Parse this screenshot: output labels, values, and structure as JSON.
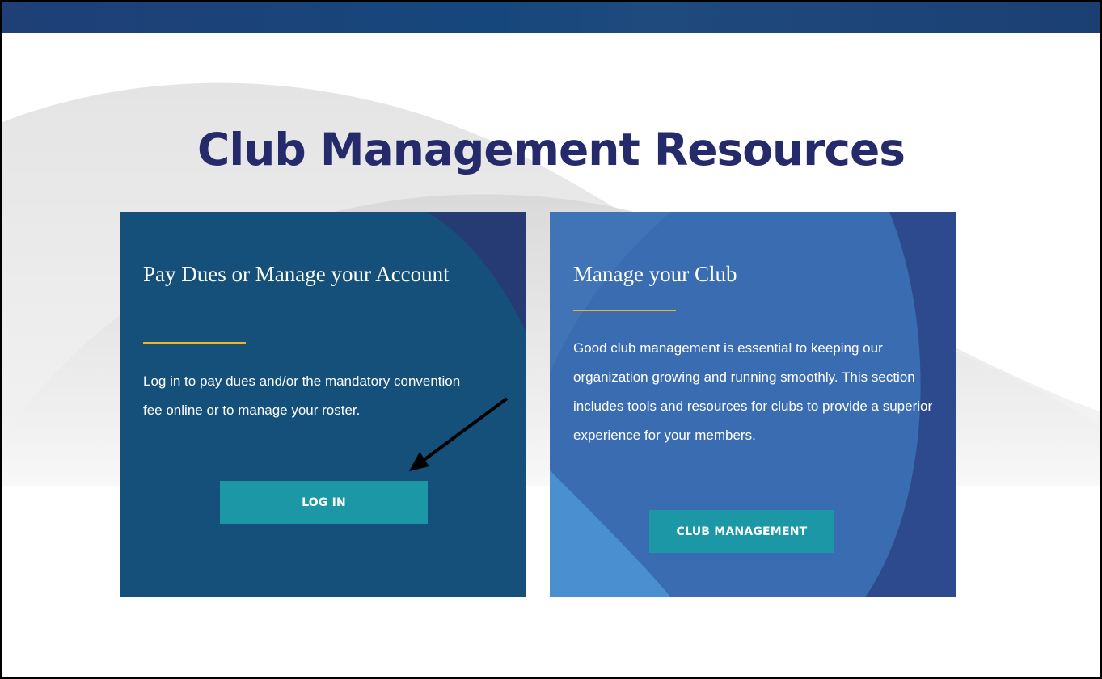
{
  "page": {
    "title": "Club Management Resources"
  },
  "cards": [
    {
      "heading": "Pay Dues or Manage your Account",
      "body": "Log in to pay dues and/or the mandatory convention fee online or to manage your roster.",
      "button_label": "LOG IN"
    },
    {
      "heading": "Manage your Club",
      "body": "Good club management is essential to keeping our organization growing and running smoothly. This section includes tools and resources for clubs to provide a superior experience for your members.",
      "button_label": "CLUB MANAGEMENT"
    }
  ],
  "annotation": {
    "icon": "arrow-icon",
    "points_to": "LOG IN"
  },
  "colors": {
    "title": "#252a6b",
    "card_left_bg": "#14507a",
    "card_right_bg": "#3a6cb2",
    "accent_rule": "#f0b323",
    "button_bg": "#1b97a6",
    "top_bar": "#1b3f73"
  }
}
